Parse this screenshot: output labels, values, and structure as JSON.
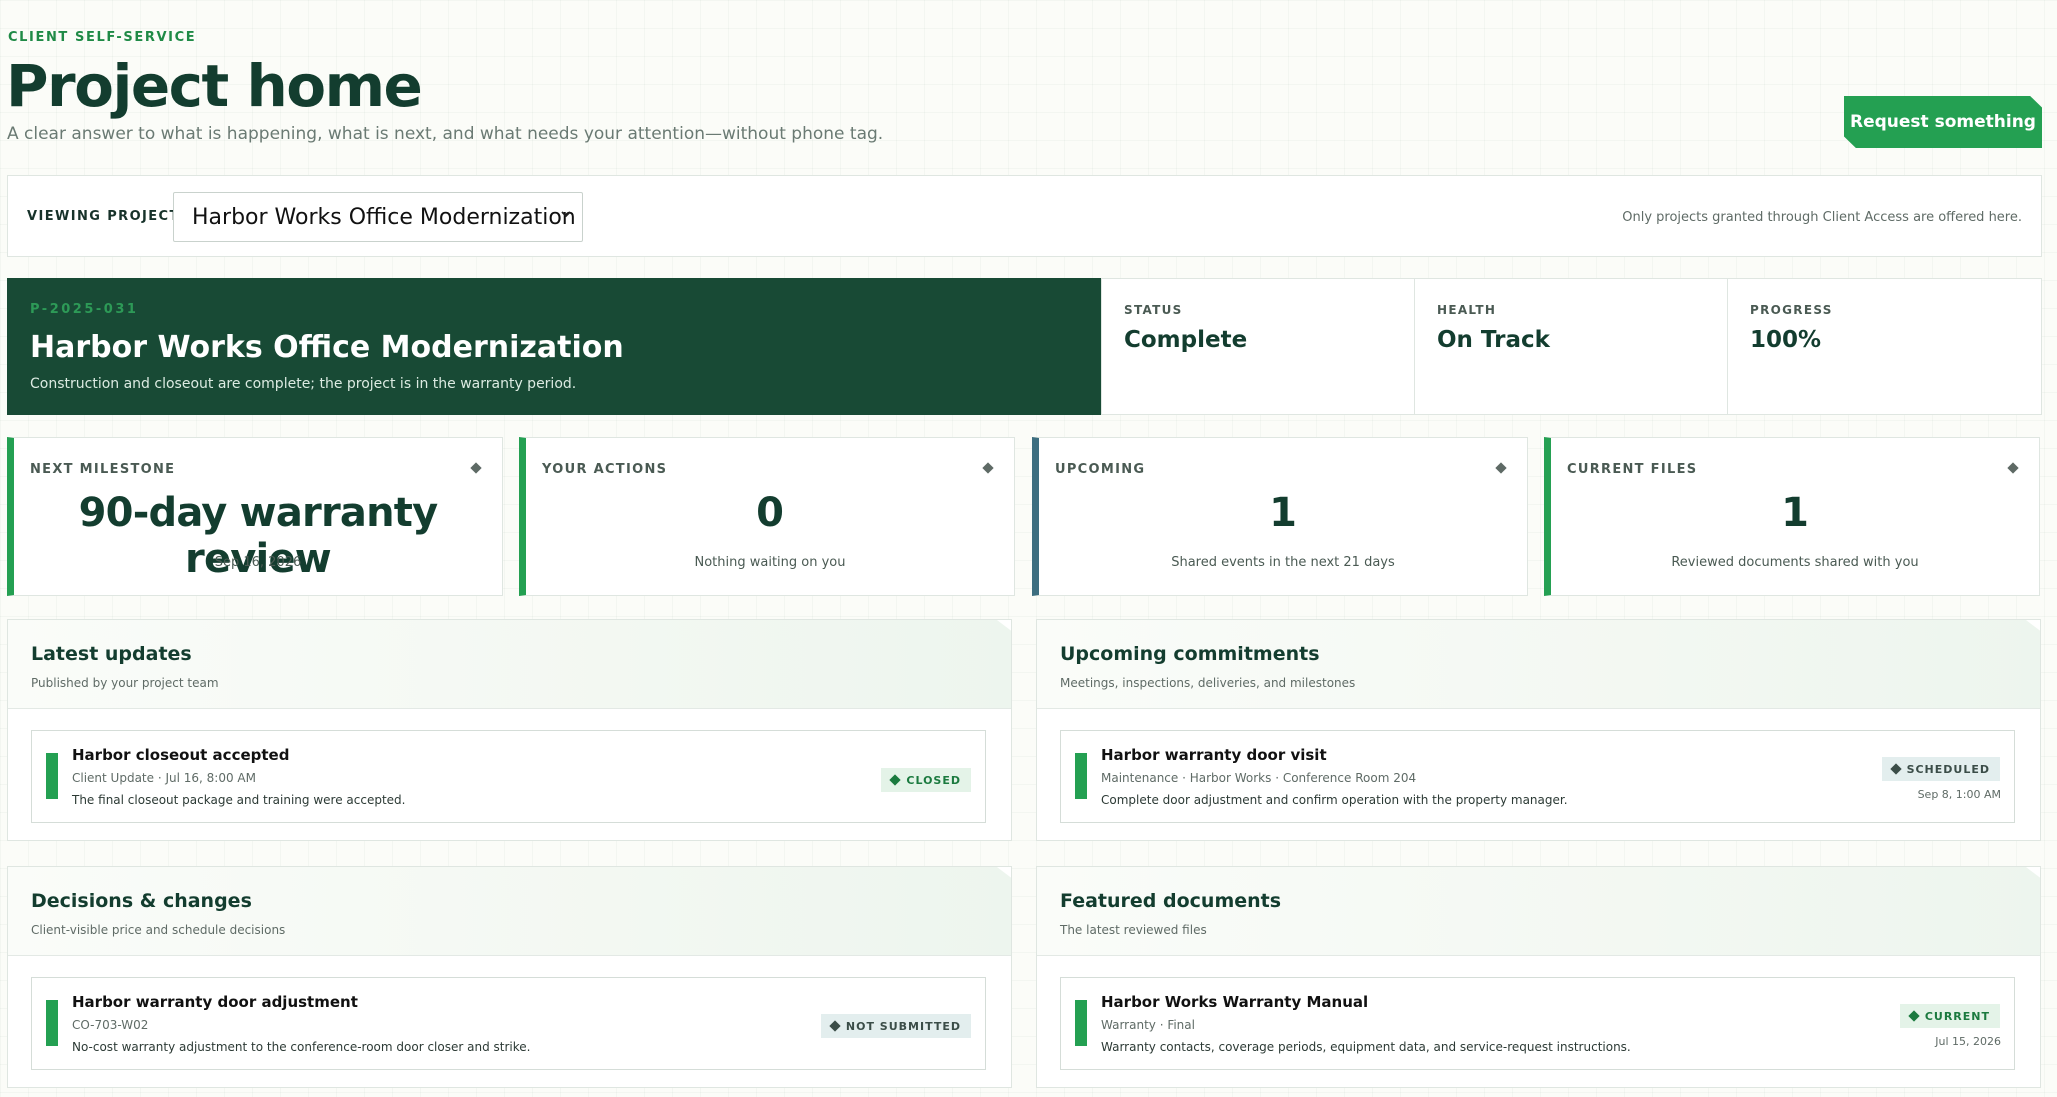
{
  "header": {
    "eyebrow": "CLIENT SELF-SERVICE",
    "title": "Project home",
    "subtitle": "A clear answer to what is happening, what is next, and what needs your attention—without phone tag.",
    "request_button": "Request something"
  },
  "selector": {
    "label": "VIEWING PROJECT",
    "selected_project": "Harbor Works Office Modernization",
    "note": "Only projects granted through Client Access are offered here."
  },
  "project": {
    "code": "P-2025-031",
    "name": "Harbor Works Office Modernization",
    "description": "Construction and closeout are complete; the project is in the warranty period.",
    "stats": [
      {
        "label": "STATUS",
        "value": "Complete"
      },
      {
        "label": "HEALTH",
        "value": "On Track"
      },
      {
        "label": "PROGRESS",
        "value": "100%"
      }
    ]
  },
  "kpis": [
    {
      "label": "NEXT MILESTONE",
      "value": "90-day warranty review",
      "sub": "Sep 16, 2026"
    },
    {
      "label": "YOUR ACTIONS",
      "value": "0",
      "sub": "Nothing waiting on you"
    },
    {
      "label": "UPCOMING",
      "value": "1",
      "sub": "Shared events in the next 21 days"
    },
    {
      "label": "CURRENT FILES",
      "value": "1",
      "sub": "Reviewed documents shared with you"
    }
  ],
  "panels": {
    "updates": {
      "title": "Latest updates",
      "subtitle": "Published by your project team",
      "item": {
        "title": "Harbor closeout accepted",
        "meta": "Client Update · Jul 16, 8:00 AM",
        "desc": "The final closeout package and training were accepted.",
        "badge": "CLOSED"
      }
    },
    "commitments": {
      "title": "Upcoming commitments",
      "subtitle": "Meetings, inspections, deliveries, and milestones",
      "item": {
        "title": "Harbor warranty door visit",
        "meta": "Maintenance · Harbor Works · Conference Room 204",
        "desc": "Complete door adjustment and confirm operation with the property manager.",
        "badge": "SCHEDULED",
        "date": "Sep 8, 1:00 AM"
      }
    },
    "decisions": {
      "title": "Decisions & changes",
      "subtitle": "Client-visible price and schedule decisions",
      "item": {
        "title": "Harbor warranty door adjustment",
        "meta": "CO-703-W02",
        "desc": "No-cost warranty adjustment to the conference-room door closer and strike.",
        "badge": "NOT SUBMITTED"
      }
    },
    "documents": {
      "title": "Featured documents",
      "subtitle": "The latest reviewed files",
      "item": {
        "title": "Harbor Works Warranty Manual",
        "meta": "Warranty · Final",
        "desc": "Warranty contacts, coverage periods, equipment data, and service-request instructions.",
        "badge": "CURRENT",
        "date": "Jul 15, 2026"
      }
    }
  },
  "colors": {
    "brand_dark": "#184a35",
    "accent_green": "#24a052",
    "accent_blue": "#3d6e80"
  }
}
